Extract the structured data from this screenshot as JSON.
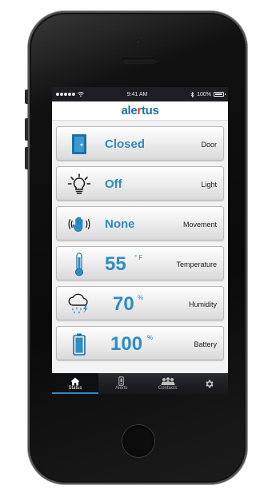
{
  "status_bar": {
    "time": "9:41 AM",
    "battery": "100%"
  },
  "app": {
    "logo_prefix": "ale",
    "logo_accent": "r",
    "logo_suffix": "tus"
  },
  "sensors": [
    {
      "value": "Closed",
      "unit": "",
      "label": "Door",
      "icon": "door-icon"
    },
    {
      "value": "Off",
      "unit": "",
      "label": "Light",
      "icon": "lightbulb-icon"
    },
    {
      "value": "None",
      "unit": "",
      "label": "Movement",
      "icon": "hand-movement-icon"
    },
    {
      "value": "55",
      "unit": "° F",
      "label": "Temperature",
      "icon": "thermometer-icon"
    },
    {
      "value": "70",
      "unit": "%",
      "label": "Humidity",
      "icon": "rain-cloud-icon"
    },
    {
      "value": "100",
      "unit": "%",
      "label": "Battery",
      "icon": "battery-icon"
    }
  ],
  "tabs": [
    {
      "label": "Status",
      "icon": "home-icon",
      "active": true
    },
    {
      "label": "Alerts",
      "icon": "alert-icon",
      "active": false
    },
    {
      "label": "Contacts",
      "icon": "contacts-icon",
      "active": false
    },
    {
      "label": "",
      "icon": "gear-icon",
      "active": false
    }
  ],
  "colors": {
    "accent": "#2e8cc4",
    "logo_accent": "#d93a2b",
    "tabbar": "#1d1e23"
  }
}
